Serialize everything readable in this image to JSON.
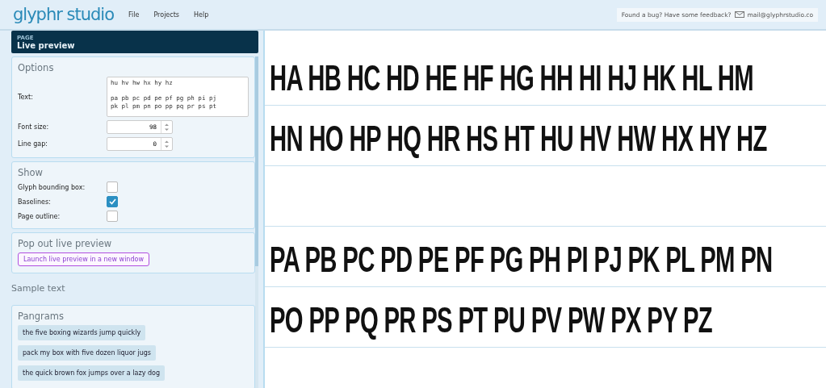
{
  "app": {
    "logo": "glyphr studio",
    "menu": [
      "File",
      "Projects",
      "Help"
    ],
    "feedback": {
      "text": "Found a bug? Have some feedback?",
      "email": "mail@glyphrstudio.co"
    }
  },
  "page": {
    "label": "PAGE",
    "title": "Live preview"
  },
  "options": {
    "title": "Options",
    "text_label": "Text:",
    "text_value": "hu hv hw hx hy hz\n\npa pb pc pd pe pf pg ph pi pj\npk pl pm pn po pp pq pr ps pt",
    "font_size_label": "Font size:",
    "font_size": "98",
    "line_gap_label": "Line gap:",
    "line_gap": "0"
  },
  "show": {
    "title": "Show",
    "items": [
      {
        "label": "Glyph bounding box:",
        "checked": false
      },
      {
        "label": "Baselines:",
        "checked": true
      },
      {
        "label": "Page outline:",
        "checked": false
      }
    ]
  },
  "popout": {
    "title": "Pop out live preview",
    "button": "Launch live preview in a new window"
  },
  "sample_text": {
    "title": "Sample text",
    "pangrams_title": "Pangrams",
    "pangrams": [
      "the five boxing wizards jump quickly",
      "pack my box with five dozen liquor jugs",
      "the quick brown fox jumps over a lazy dog"
    ]
  },
  "preview": {
    "paragraphs": [
      [
        "HA HB HC HD HE HF HG HH HI HJ HK HL HM",
        "HN HO HP HQ HR HS HT HU HV HW HX HY HZ"
      ],
      [
        "PA PB PC PD PE PF PG PH PI PJ PK PL PM PN",
        "PO PP PQ PR PS PT PU PV PW PX PY PZ"
      ]
    ]
  }
}
